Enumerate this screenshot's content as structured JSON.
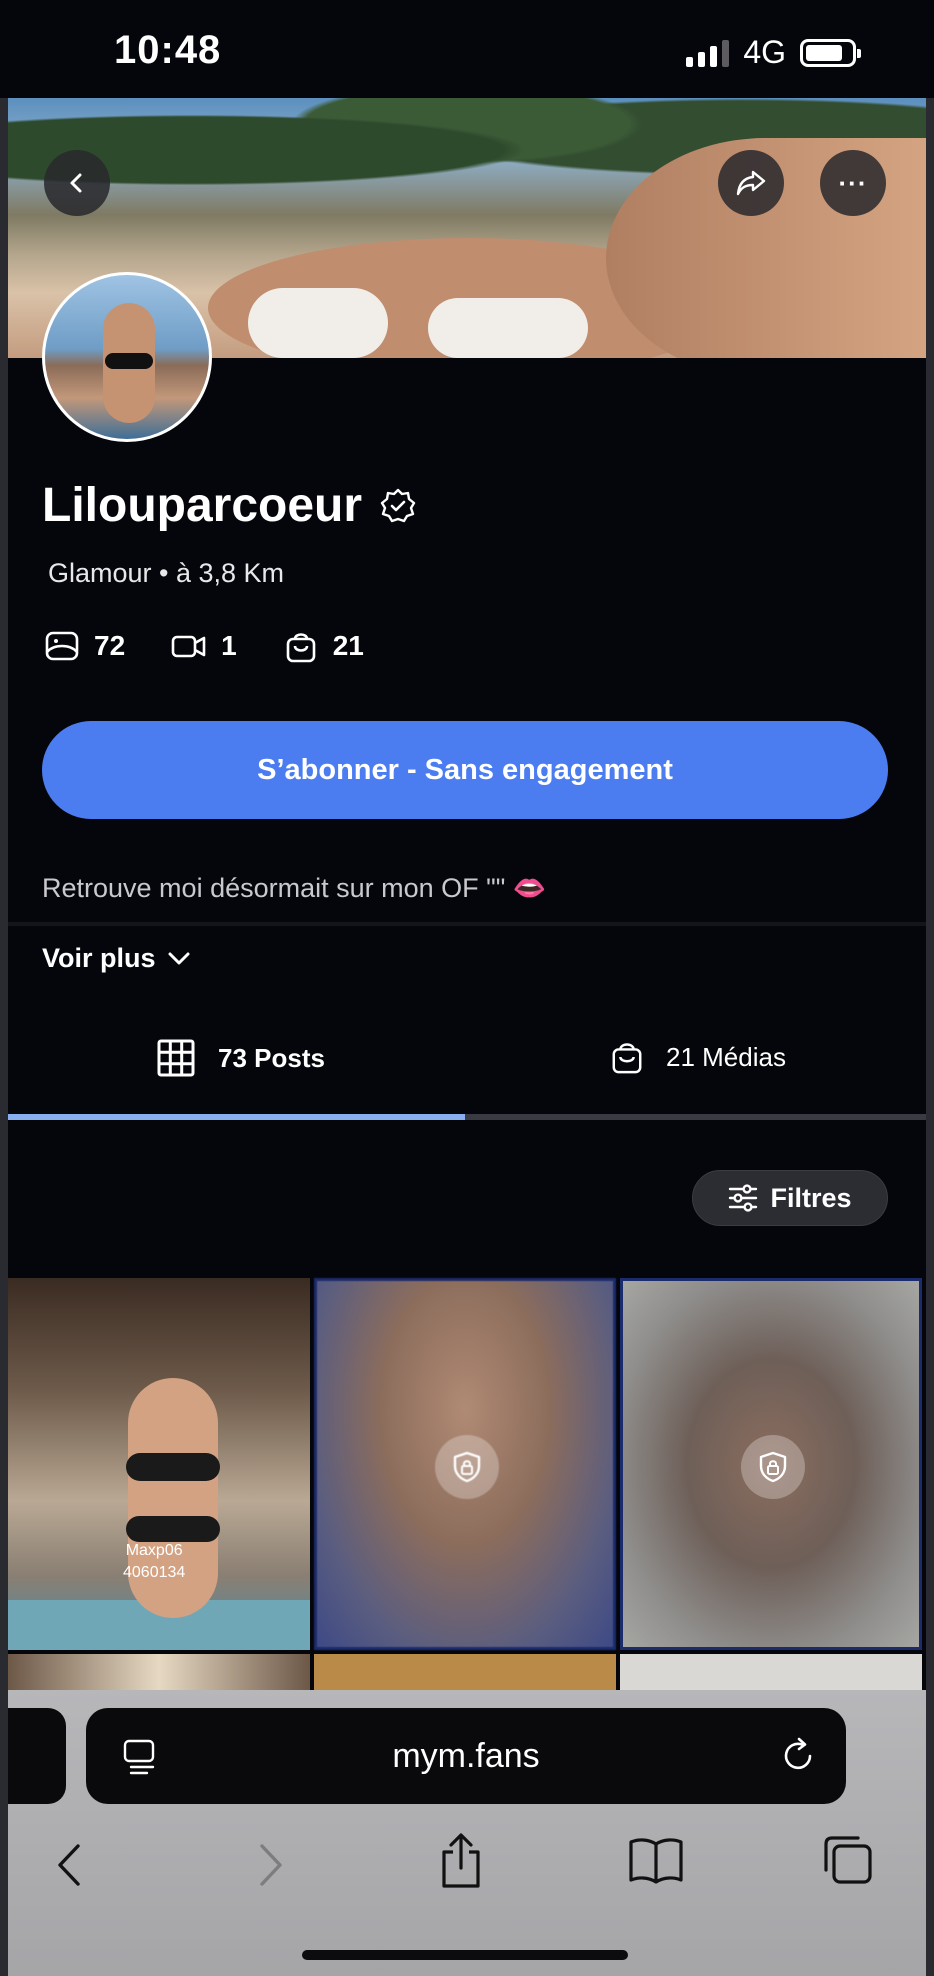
{
  "status_bar": {
    "time": "10:48",
    "network": "4G"
  },
  "profile": {
    "name": "Lilouparcoeur",
    "subtitle": "Glamour • à 3,8 Km",
    "stats": {
      "photos": "72",
      "videos": "1",
      "medias": "21"
    },
    "subscribe_label": "S’abonner - Sans engagement",
    "bio": "Retrouve moi désormait sur mon OF \"\" 👄",
    "see_more": "Voir plus"
  },
  "tabs": {
    "posts": "73 Posts",
    "medias": "21 Médias",
    "active": "posts"
  },
  "filters_label": "Filtres",
  "grid": {
    "watermark": "Maxp06\n4060134"
  },
  "browser": {
    "url": "mym.fans"
  },
  "colors": {
    "accent": "#4c7df0",
    "background": "#05060b",
    "tab_indicator": "#89aef0"
  },
  "icons": [
    "back-icon",
    "share-icon",
    "more-icon",
    "verified-icon",
    "photo-icon",
    "video-icon",
    "bag-icon",
    "grid-icon",
    "filter-icon",
    "lock-icon",
    "reader-icon",
    "reload-icon",
    "back-nav-icon",
    "forward-nav-icon",
    "share-sheet-icon",
    "bookmarks-icon",
    "tabs-icon"
  ]
}
